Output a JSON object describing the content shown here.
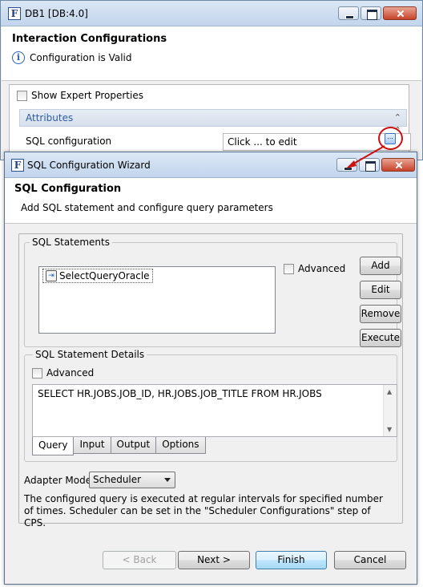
{
  "back_window": {
    "title": "DB1 [DB:4.0]",
    "app_icon_letter": "F",
    "header_title": "Interaction Configurations",
    "status_text": "Configuration is Valid",
    "show_expert_label": "Show Expert Properties",
    "show_expert_checked": false,
    "attributes_header": "Attributes",
    "sql_config_label": "SQL configuration",
    "sql_config_value": "Click ... to edit",
    "ellipsis_button": "..."
  },
  "wizard": {
    "title": "SQL Configuration Wizard",
    "app_icon_letter": "F",
    "header_title": "SQL Configuration",
    "header_subtitle": "Add SQL statement and configure query parameters",
    "statements_group": {
      "legend": "SQL Statements",
      "items": [
        "SelectQueryOracle"
      ],
      "advanced_label": "Advanced",
      "advanced_checked": false,
      "buttons": {
        "add": "Add",
        "edit": "Edit",
        "remove": "Remove",
        "execute": "Execute"
      }
    },
    "details_group": {
      "legend": "SQL Statement Details",
      "advanced_label": "Advanced",
      "advanced_checked": false,
      "statement_text": "SELECT HR.JOBS.JOB_ID, HR.JOBS.JOB_TITLE FROM HR.JOBS",
      "tabs": [
        "Query",
        "Input",
        "Output",
        "Options"
      ],
      "active_tab": "Query"
    },
    "adapter_mode_label": "Adapter Mode",
    "adapter_mode_value": "Scheduler",
    "description": "The configured query is executed at regular intervals for specified number of times. Scheduler can be set in the \"Scheduler Configurations\" step of CPS.",
    "footer_buttons": {
      "back": "< Back",
      "next": "Next >",
      "finish": "Finish",
      "cancel": "Cancel"
    }
  },
  "colors": {
    "titlebar_top": "#dbe7f5",
    "titlebar_bottom": "#c2d5ec",
    "attributes_text": "#2f5d9e",
    "highlight_circle": "#cc1111",
    "window_bg": "#f0f0f0"
  },
  "icons": [
    "app-icon",
    "info-icon",
    "collapse-icon",
    "ellipsis-icon",
    "database-query-icon",
    "minimize-icon",
    "maximize-icon",
    "close-icon",
    "dropdown-arrow-icon"
  ]
}
